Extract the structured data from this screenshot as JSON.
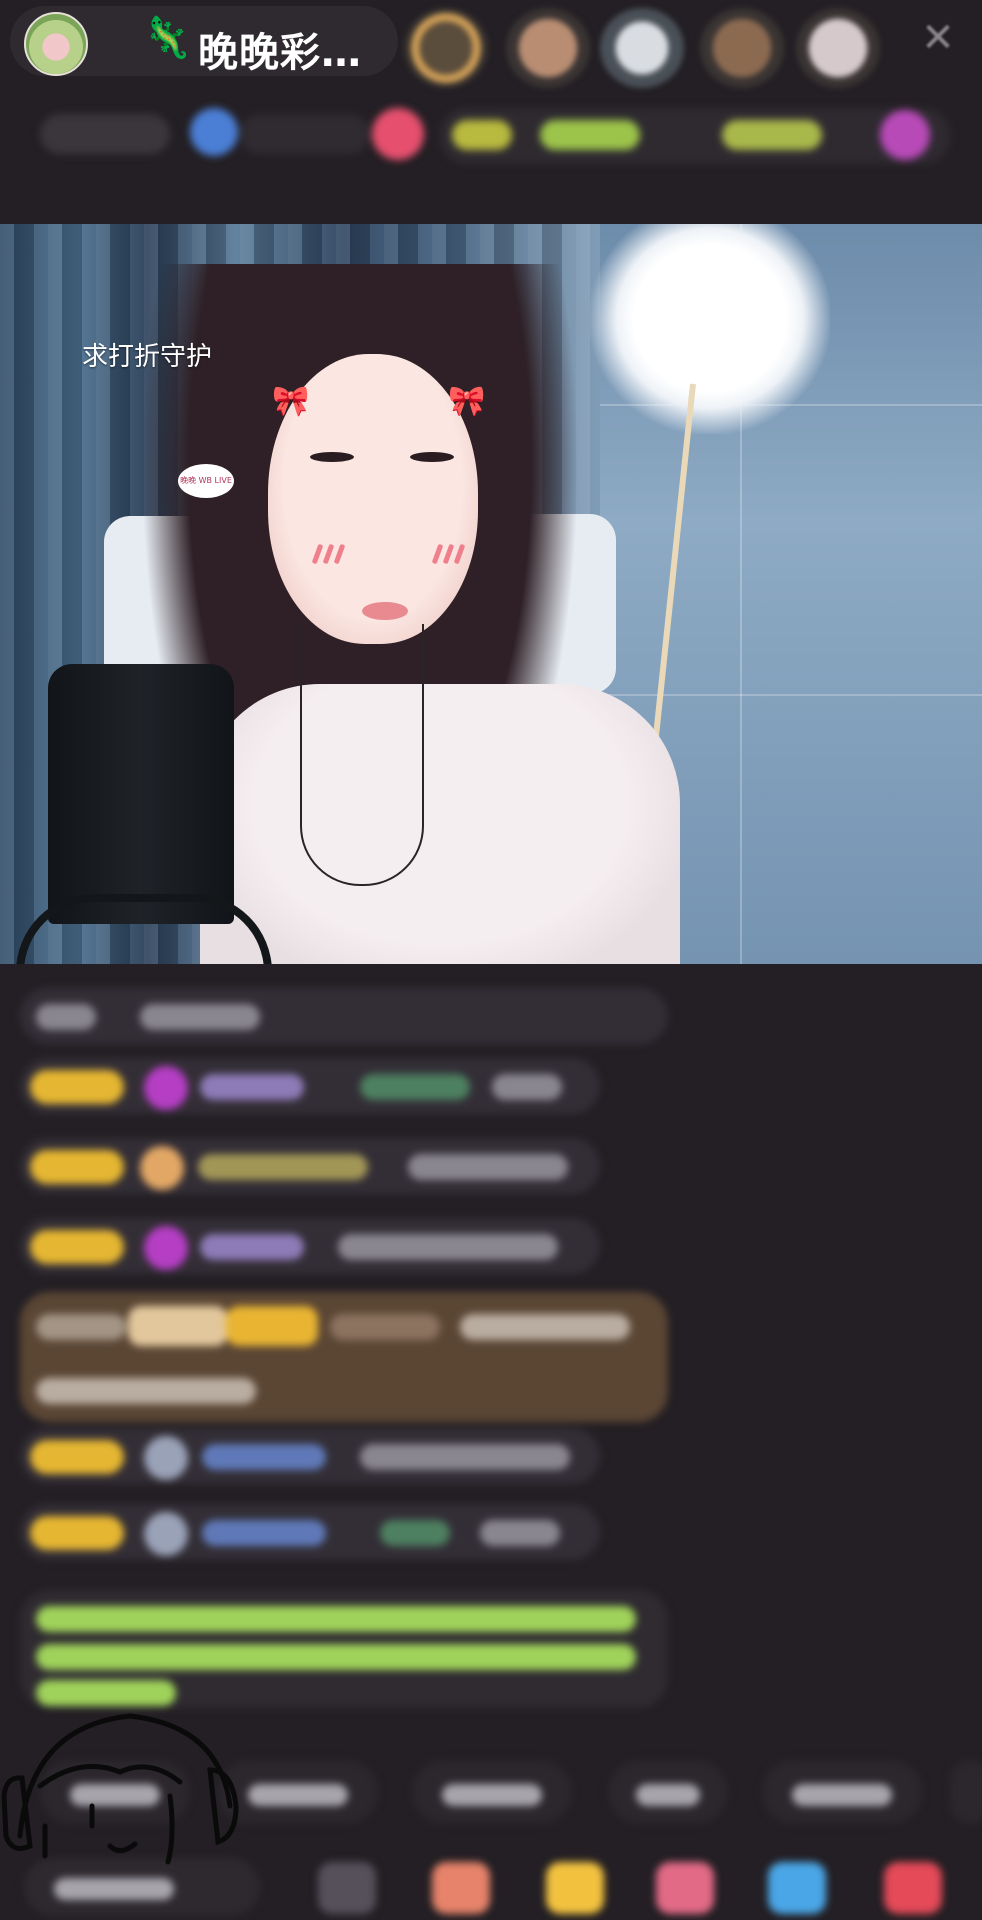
{
  "header": {
    "host_name": "晚晚彩…",
    "host_icon": "gecko-icon",
    "close_label": "✕"
  },
  "video": {
    "sticker_text": "求打折守护",
    "bubble_text": "晚晚 WB LIVE"
  },
  "colors": {
    "background": "#231f24",
    "badge": "#e5b632",
    "accent_purple": "#b84ab8",
    "accent_green": "#9fd25a"
  }
}
